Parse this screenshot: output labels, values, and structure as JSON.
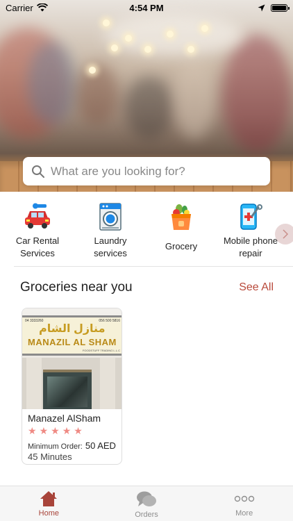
{
  "status_bar": {
    "carrier": "Carrier",
    "time": "4:54 PM"
  },
  "search": {
    "placeholder": "What are you looking for?"
  },
  "categories": [
    {
      "label_line1": "Car Rental",
      "label_line2": "Services",
      "icon": "car-icon"
    },
    {
      "label_line1": "Laundry",
      "label_line2": "services",
      "icon": "washing-machine-icon"
    },
    {
      "label_line1": "Grocery",
      "label_line2": "",
      "icon": "grocery-bag-icon"
    },
    {
      "label_line1": "Mobile phone",
      "label_line2": "repair",
      "icon": "phone-repair-icon"
    }
  ],
  "groceries": {
    "title": "Groceries near you",
    "see_all": "See All",
    "stores": [
      {
        "name": "Manazel AlSham",
        "rating": 5,
        "min_order_label": "Minimum Order:",
        "min_order_value": "50 AED",
        "delivery_time": "45 Minutes",
        "sign_arabic": "منازل الشام",
        "sign_english": "MANAZIL AL SHAM",
        "sign_phone_left": "04 3333260",
        "sign_phone_right": "056 500 5816",
        "sign_subtitle": "FOODSTUFF TRADING L.L.C"
      }
    ]
  },
  "tabs": [
    {
      "label": "Home",
      "icon": "home-icon",
      "active": true
    },
    {
      "label": "Orders",
      "icon": "chat-bubbles-icon",
      "active": false
    },
    {
      "label": "More",
      "icon": "more-dots-icon",
      "active": false
    }
  ],
  "colors": {
    "accent": "#a8443a",
    "see_all": "#b94a3b",
    "star": "#ef8a84"
  }
}
